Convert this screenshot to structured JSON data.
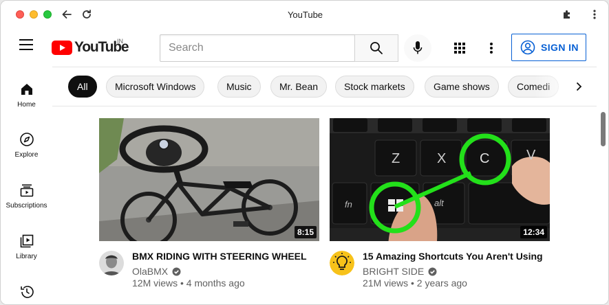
{
  "window": {
    "title": "YouTube"
  },
  "header": {
    "logo_text": "YouTube",
    "region": "IN",
    "search_placeholder": "Search",
    "signin_label": "SIGN IN"
  },
  "chips": [
    "All",
    "Microsoft Windows",
    "Music",
    "Mr. Bean",
    "Stock markets",
    "Game shows",
    "Comedi"
  ],
  "sidebar": {
    "items": [
      {
        "label": "Home",
        "icon": "home-icon"
      },
      {
        "label": "Explore",
        "icon": "compass-icon"
      },
      {
        "label": "Subscriptions",
        "icon": "subscriptions-icon"
      },
      {
        "label": "Library",
        "icon": "library-icon"
      },
      {
        "label": "",
        "icon": "history-icon"
      }
    ]
  },
  "videos": [
    {
      "title": "BMX RIDING WITH STEERING WHEEL",
      "channel": "OlaBMX",
      "stats": "12M views • 4 months ago",
      "duration": "8:15"
    },
    {
      "title": "15 Amazing Shortcuts You Aren't Using",
      "channel": "BRIGHT SIDE",
      "stats": "21M views • 2 years ago",
      "duration": "12:34",
      "keys": {
        "z": "Z",
        "x": "X",
        "c": "C",
        "v": "V",
        "fn": "fn",
        "alt": "alt"
      }
    }
  ],
  "colors": {
    "brand_red": "#ff0000",
    "link_blue": "#065fd4",
    "bright_side_yellow": "#f7c21a"
  }
}
